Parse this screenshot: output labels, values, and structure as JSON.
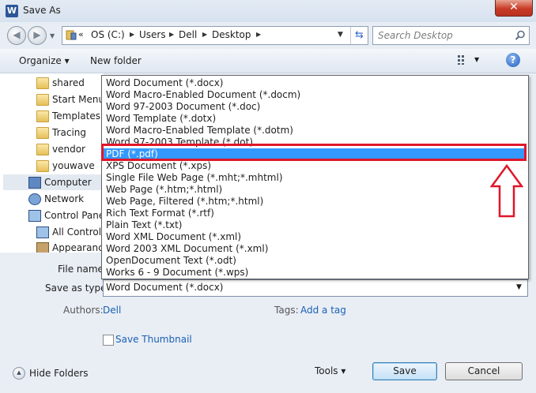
{
  "window": {
    "title": "Save As",
    "app_icon": "W"
  },
  "address_bar": {
    "crumbs": [
      "OS (C:)",
      "Users",
      "Dell",
      "Desktop"
    ],
    "search_placeholder": "Search Desktop"
  },
  "toolbar": {
    "organize": "Organize ▾",
    "new_folder": "New folder"
  },
  "nav_pane": {
    "items": [
      "shared",
      "Start Menu",
      "Templates",
      "Tracing",
      "vendor",
      "youwave",
      "Computer",
      "Network",
      "Control Panel",
      "All Control P",
      "Appearance"
    ]
  },
  "file_types": [
    "Word Document (*.docx)",
    "Word Macro-Enabled Document (*.docm)",
    "Word 97-2003 Document (*.doc)",
    "Word Template (*.dotx)",
    "Word Macro-Enabled Template (*.dotm)",
    "Word 97-2003 Template (*.dot)",
    "PDF (*.pdf)",
    "XPS Document (*.xps)",
    "Single File Web Page (*.mht;*.mhtml)",
    "Web Page (*.htm;*.html)",
    "Web Page, Filtered (*.htm;*.html)",
    "Rich Text Format (*.rtf)",
    "Plain Text (*.txt)",
    "Word XML Document (*.xml)",
    "Word 2003 XML Document (*.xml)",
    "OpenDocument Text (*.odt)",
    "Works 6 - 9 Document (*.wps)"
  ],
  "selected_type": "PDF (*.pdf)",
  "form": {
    "file_name_label": "File name:",
    "save_as_type_label": "Save as type:",
    "save_as_type_value": "Word Document (*.docx)",
    "authors_label": "Authors:",
    "authors_value": "Dell",
    "tags_label": "Tags:",
    "tags_value": "Add a tag",
    "save_thumbnail": "Save Thumbnail"
  },
  "footer": {
    "hide_folders": "Hide Folders",
    "tools": "Tools ▾",
    "save": "Save",
    "cancel": "Cancel"
  },
  "colors": {
    "selection": "#3399ff",
    "annotation": "#e0162b",
    "close_button": "#c73b26"
  }
}
